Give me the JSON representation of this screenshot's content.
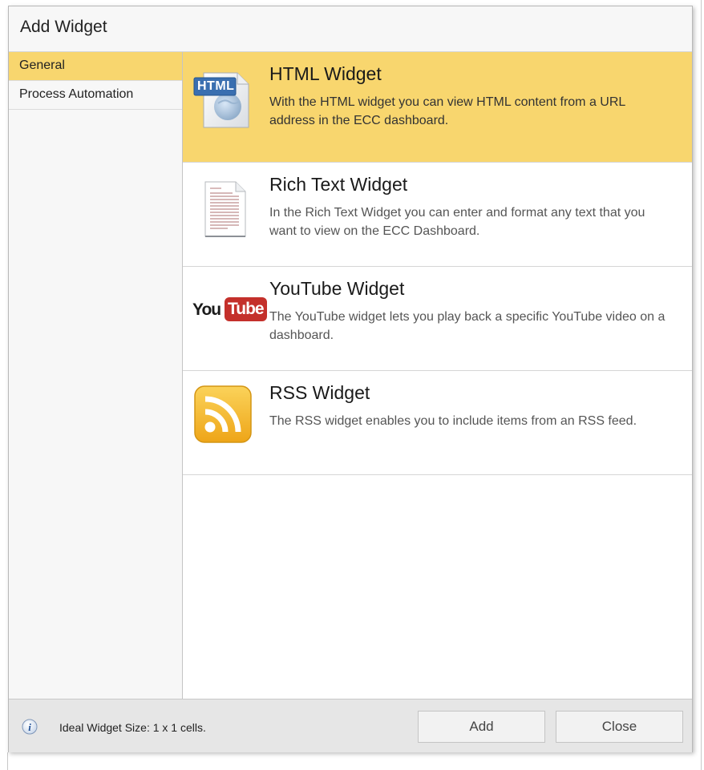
{
  "dialog": {
    "title": "Add Widget"
  },
  "sidebar": {
    "items": [
      {
        "label": "General",
        "active": true
      },
      {
        "label": "Process Automation",
        "active": false
      }
    ]
  },
  "widgets": [
    {
      "title": "HTML Widget",
      "description": "With the HTML widget you can view HTML content from a URL address in the ECC dashboard.",
      "icon": "html-document-icon",
      "icon_label": "HTML",
      "selected": true
    },
    {
      "title": "Rich Text Widget",
      "description": "In the Rich Text Widget you can enter and format any text that you want to view on the ECC Dashboard.",
      "icon": "rich-text-document-icon",
      "selected": false
    },
    {
      "title": "YouTube Widget",
      "description": "The YouTube widget lets you play back a specific YouTube video on a dashboard.",
      "icon": "youtube-logo-icon",
      "icon_label_a": "You",
      "icon_label_b": "Tube",
      "selected": false
    },
    {
      "title": "RSS Widget",
      "description": "The RSS widget enables you to include items from an RSS feed.",
      "icon": "rss-feed-icon",
      "selected": false
    }
  ],
  "footer": {
    "info_text": "Ideal Widget Size: 1 x 1 cells.",
    "add_label": "Add",
    "close_label": "Close"
  },
  "colors": {
    "selected_background": "#f8d66e",
    "rss_orange": "#f3b01f",
    "youtube_red": "#c4302b"
  }
}
